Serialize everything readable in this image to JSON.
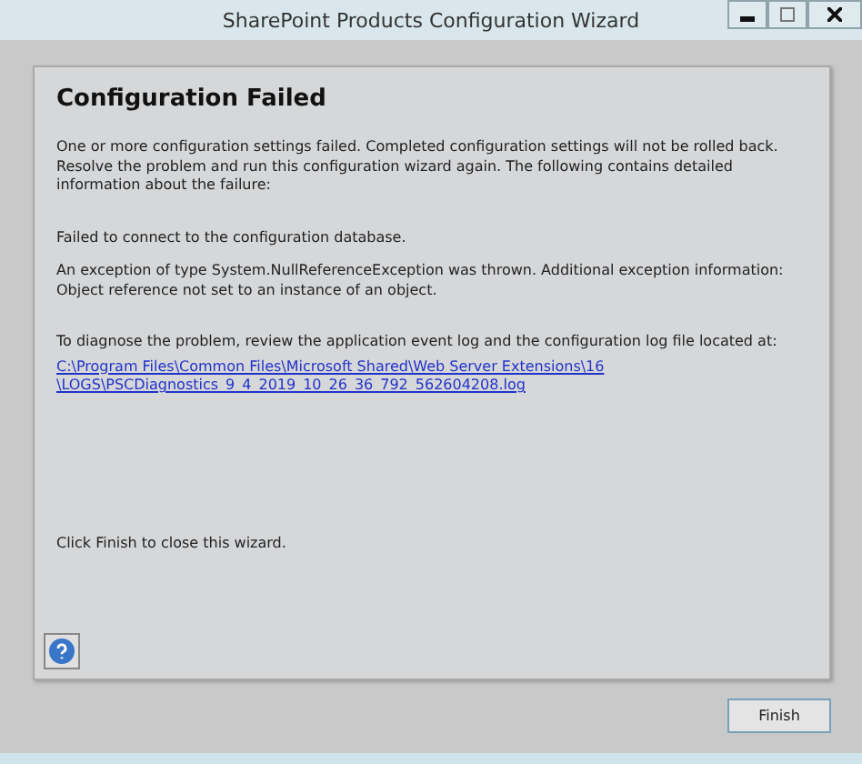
{
  "window": {
    "title": "SharePoint Products Configuration Wizard"
  },
  "heading": "Configuration Failed",
  "intro": "One or more configuration settings failed.  Completed configuration settings will not be rolled back. Resolve the problem and run this configuration wizard again. The following contains detailed information about the failure:",
  "error": "Failed to connect to the configuration database.",
  "exception": "An exception of type System.NullReferenceException was thrown.  Additional exception information: Object reference not set to an instance of an object.",
  "diagnose": "To diagnose the problem, review the application event log and the configuration log file located at:",
  "log_link": [
    "C:\\Program Files\\Common Files\\Microsoft Shared\\Web Server Extensions\\16",
    "\\LOGS\\PSCDiagnostics_9_4_2019_10_26_36_792_562604208.log"
  ],
  "closing": "Click Finish to close this wizard.",
  "buttons": [
    "Finish"
  ]
}
